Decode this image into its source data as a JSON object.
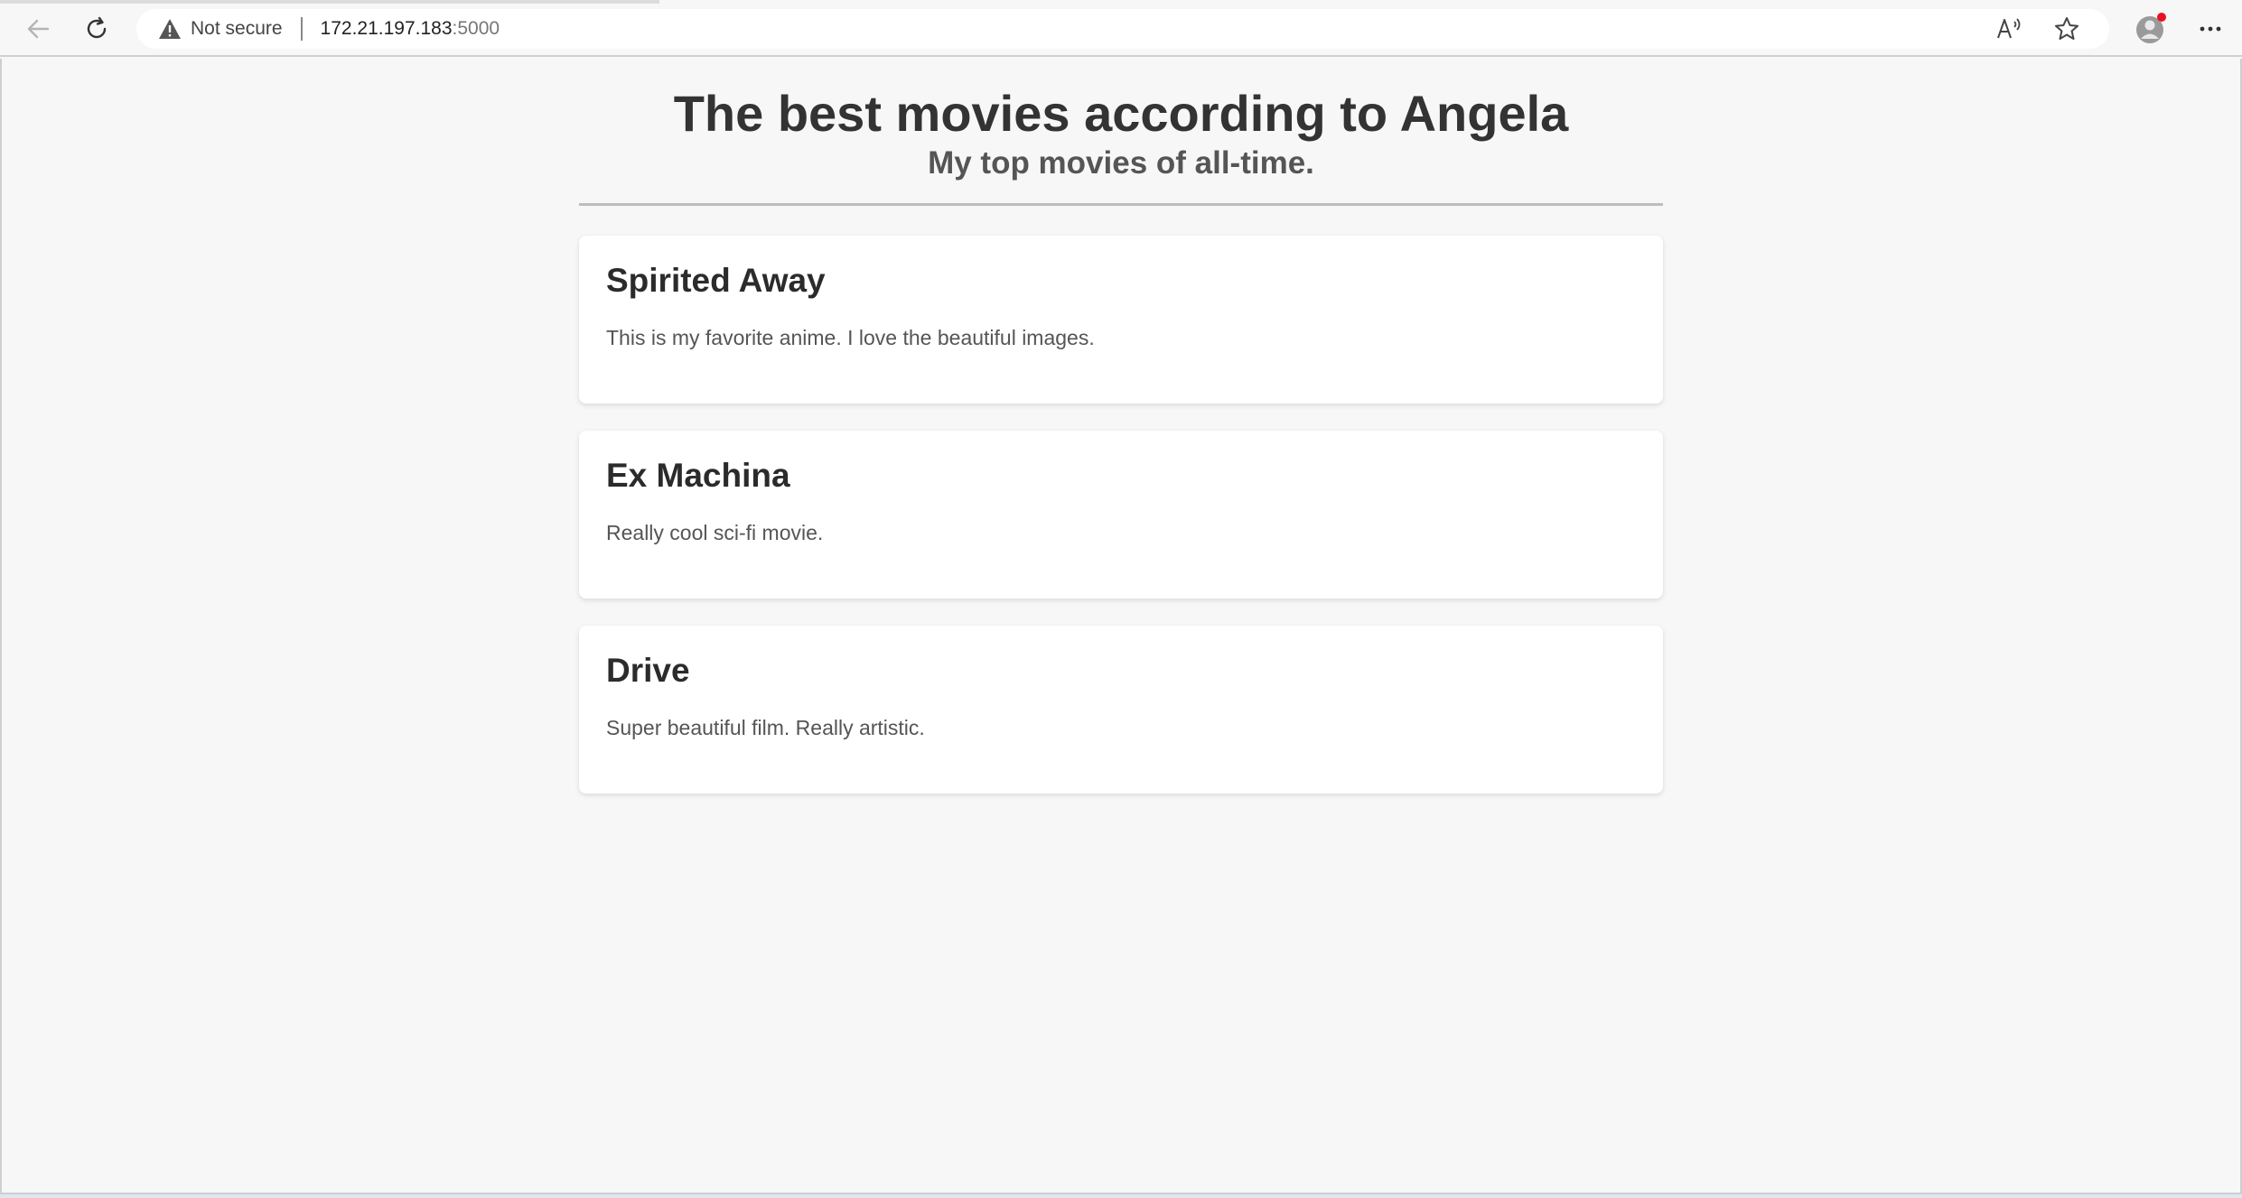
{
  "browser": {
    "security_label": "Not secure",
    "url_host": "172.21.197.183",
    "url_port": ":5000",
    "icons": [
      "back-icon",
      "refresh-icon",
      "warning-icon",
      "read-aloud-icon",
      "favorite-star-icon",
      "profile-icon",
      "more-icon"
    ]
  },
  "header": {
    "title": "The best movies according to Angela",
    "subtitle": "My top movies of all-time."
  },
  "movies": [
    {
      "title": "Spirited Away",
      "description": "This is my favorite anime. I love the beautiful images."
    },
    {
      "title": "Ex Machina",
      "description": "Really cool sci-fi movie."
    },
    {
      "title": "Drive",
      "description": "Super beautiful film. Really artistic."
    }
  ],
  "colors": {
    "background": "#f7f7f7",
    "card": "#ffffff",
    "title_text": "#333333",
    "body_text": "#555555",
    "notification_dot": "#e81123"
  }
}
